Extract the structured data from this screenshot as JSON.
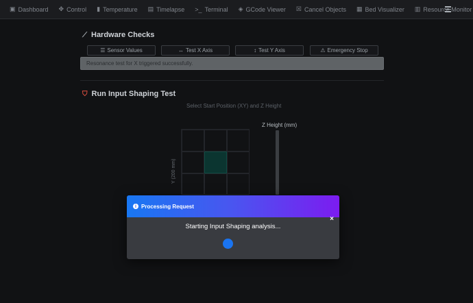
{
  "nav": {
    "items": [
      {
        "label": "Dashboard",
        "icon": "dashboard-icon",
        "glyph": "▣"
      },
      {
        "label": "Control",
        "icon": "move-icon",
        "glyph": "✥"
      },
      {
        "label": "Temperature",
        "icon": "thermometer-icon",
        "glyph": "▮"
      },
      {
        "label": "Timelapse",
        "icon": "film-icon",
        "glyph": "▤"
      },
      {
        "label": "Terminal",
        "icon": "terminal-icon",
        "glyph": ">_"
      },
      {
        "label": "GCode Viewer",
        "icon": "cube-icon",
        "glyph": "◈"
      },
      {
        "label": "Cancel Objects",
        "icon": "cancel-objects-icon",
        "glyph": "☒"
      },
      {
        "label": "Bed Visualizer",
        "icon": "bed-icon",
        "glyph": "▦"
      },
      {
        "label": "Resource Monitor",
        "icon": "monitor-icon",
        "glyph": "▥"
      }
    ]
  },
  "hardware": {
    "title": "Hardware Checks",
    "buttons": [
      {
        "label": "Sensor Values",
        "glyph": "☰"
      },
      {
        "label": "Test X Axis",
        "glyph": "↔"
      },
      {
        "label": "Test Y Axis",
        "glyph": "↕"
      },
      {
        "label": "Emergency Stop",
        "glyph": "⚠"
      }
    ],
    "alert": "Resonance test for X triggered successfully."
  },
  "shaping": {
    "title": "Run Input Shaping Test",
    "subtitle": "Select Start Position (XY) and Z Height",
    "y_axis_label": "Y (200 mm)",
    "z_label": "Z Height (mm)"
  },
  "modal": {
    "title": "Processing Request",
    "message": "Starting Input Shaping analysis...",
    "close_glyph": "×",
    "header_colors": [
      "#1877f2",
      "#7c1cf0"
    ],
    "spinner_color": "#1a74f0"
  }
}
